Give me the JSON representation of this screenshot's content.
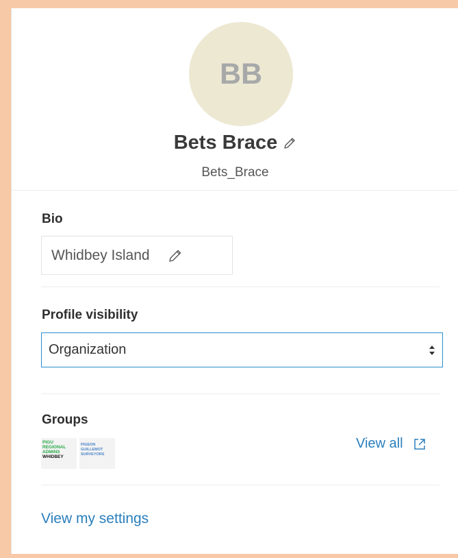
{
  "profile": {
    "initials": "BB",
    "name": "Bets Brace",
    "username": "Bets_Brace"
  },
  "bio": {
    "label": "Bio",
    "value": "Whidbey Island"
  },
  "visibility": {
    "label": "Profile visibility",
    "selected": "Organization"
  },
  "groups": {
    "label": "Groups",
    "items": [
      {
        "lines": [
          "PIGU",
          "REGIONAL",
          "ADMINS",
          "WHIDBEY"
        ]
      },
      {
        "lines": [
          "PIGEON",
          "GUILLEMOT",
          "SURVEYORS"
        ]
      }
    ],
    "view_all_label": "View all"
  },
  "links": {
    "settings_label": "View my settings"
  },
  "colors": {
    "background": "#f8c9a6",
    "avatar_bg": "#ede8d2",
    "link": "#2a7fbd",
    "focus_border": "#2a8ed0"
  },
  "icons": {
    "name_edit": "pencil-icon",
    "bio_edit": "pencil-icon",
    "select": "updown-arrows-icon",
    "view_all": "external-link-icon"
  }
}
